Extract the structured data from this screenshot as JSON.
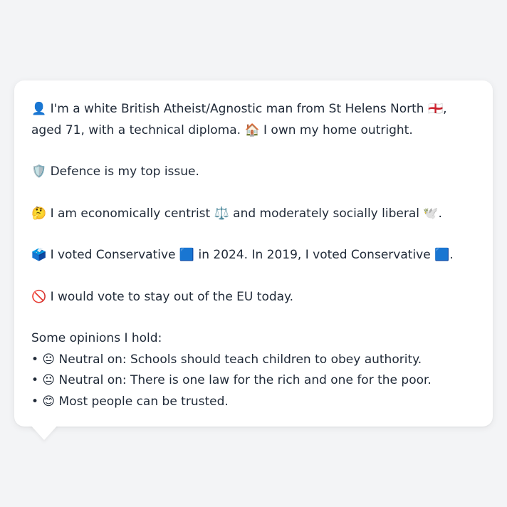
{
  "bio": {
    "line1": "👤 I'm a white British Atheist/Agnostic man from St Helens North 🏴󠁧󠁢󠁥󠁮󠁧󠁿, aged 71, with a technical diploma. 🏠 I own my home outright.",
    "top_issue": "🛡️ Defence is my top issue.",
    "ideology": "🤔 I am economically centrist ⚖️ and moderately socially liberal 🕊️.",
    "voting": "🗳️ I voted Conservative 🟦 in 2024. In 2019, I voted Conservative 🟦.",
    "eu": "🚫 I would vote to stay out of the EU today."
  },
  "opinions": {
    "heading": "Some opinions I hold:",
    "items": [
      "• 😐 Neutral on: Schools should teach children to obey authority.",
      "• 😐 Neutral on: There is one law for the rich and one for the poor.",
      "• 😊 Most people can be trusted."
    ]
  }
}
